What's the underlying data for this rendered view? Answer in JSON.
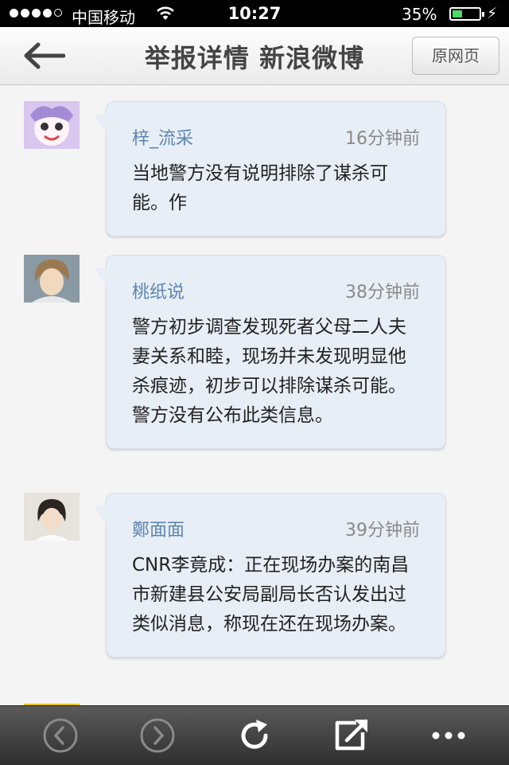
{
  "status_bar": {
    "carrier": "中国移动",
    "time": "10:27",
    "battery_percent": "35%",
    "signal_bars": 4,
    "signal_total": 5,
    "battery_level": 0.35
  },
  "nav": {
    "title": "举报详情 新浪微博",
    "original_page_label": "原网页"
  },
  "comments": [
    {
      "name": "梓_流采",
      "time": "16分钟前",
      "text": "当地警方没有说明排除了谋杀可能。作"
    },
    {
      "name": "桃纸说",
      "time": "38分钟前",
      "text": "警方初步调查发现死者父母二人夫妻关系和睦，现场并未发现明显他杀痕迹，初步可以排除谋杀可能。 警方没有公布此类信息。"
    },
    {
      "name": "鄭面面",
      "time": "39分钟前",
      "text": "CNR李竟成：正在现场办案的南昌市新建县公安局副局长否认发出过类似消息，称现在还在现场办案。"
    }
  ],
  "toolbar": [
    "back-circle-icon",
    "forward-circle-icon",
    "refresh-icon",
    "share-icon",
    "more-icon"
  ],
  "colors": {
    "username": "#5d86b1",
    "bubble": "#e7eef6",
    "battery_fill": "#4cd964"
  }
}
